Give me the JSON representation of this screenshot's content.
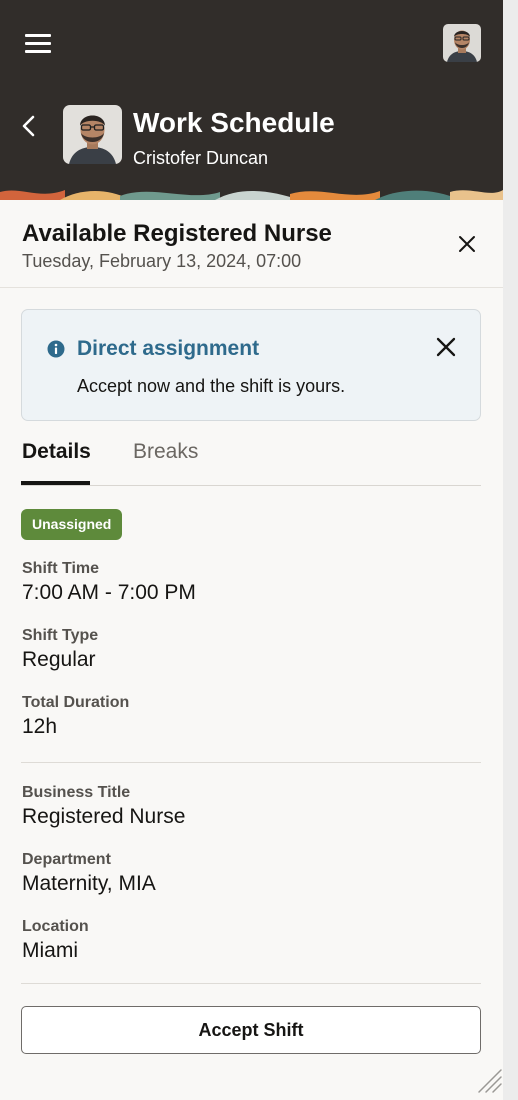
{
  "header": {
    "title": "Work Schedule",
    "subtitle": "Cristofer Duncan",
    "menu_icon": "hamburger-menu-icon",
    "back_icon": "chevron-left-icon"
  },
  "sheet": {
    "title": "Available Registered Nurse",
    "date": "Tuesday, February 13, 2024, 07:00",
    "close_icon": "close-icon"
  },
  "banner": {
    "title": "Direct assignment",
    "text": "Accept now and the shift is yours.",
    "icon": "info-icon",
    "accent_color": "#2e6a8c"
  },
  "tabs": [
    {
      "label": "Details",
      "selected": true
    },
    {
      "label": "Breaks",
      "selected": false
    }
  ],
  "status_badge": {
    "label": "Unassigned",
    "color": "#5e8a3b"
  },
  "shift": {
    "time_label": "Shift Time",
    "time_value": "7:00 AM - 7:00 PM",
    "type_label": "Shift Type",
    "type_value": "Regular",
    "duration_label": "Total Duration",
    "duration_value": "12h"
  },
  "job": {
    "business_title_label": "Business Title",
    "business_title_value": "Registered Nurse",
    "department_label": "Department",
    "department_value": "Maternity, MIA",
    "location_label": "Location",
    "location_value": "Miami"
  },
  "actions": {
    "accept_label": "Accept Shift"
  },
  "colors": {
    "header_bg": "#312d2a",
    "page_bg": "#f9f8f6"
  }
}
